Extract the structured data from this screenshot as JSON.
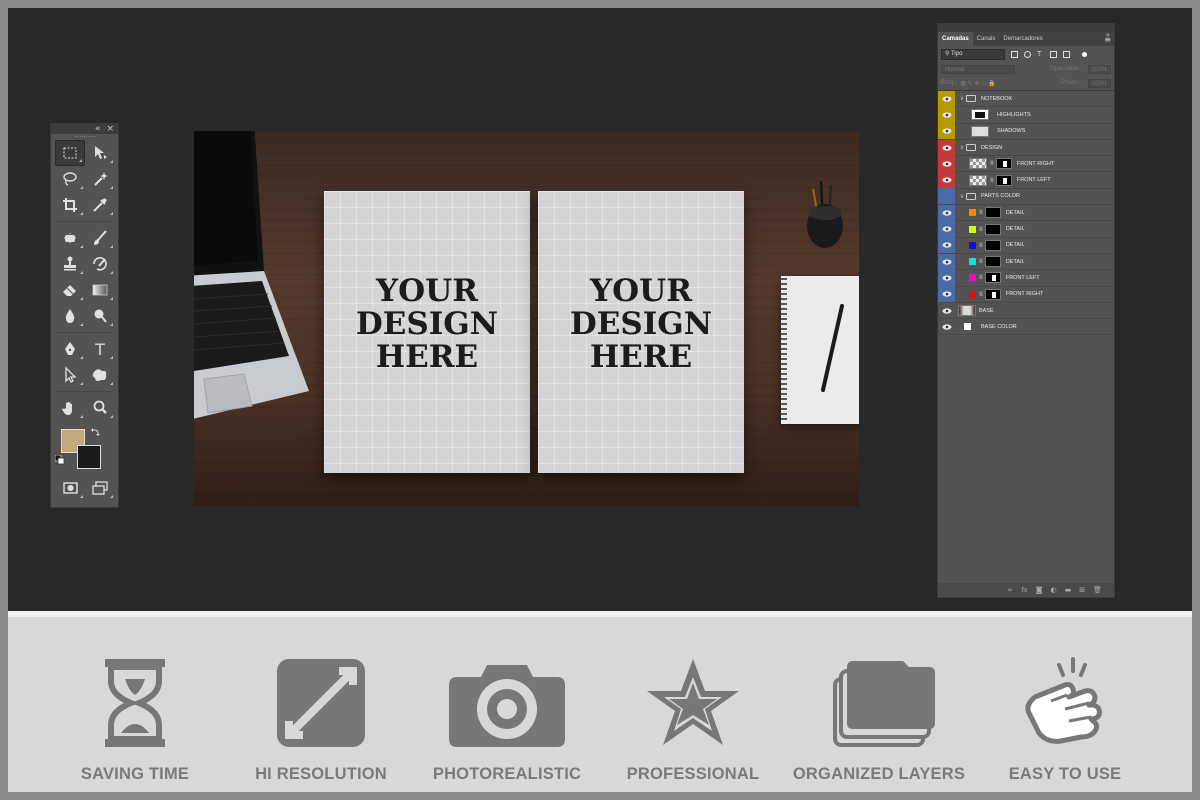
{
  "colors": {
    "workspace": "#282828",
    "panel": "#535353",
    "foreground_swatch": "#c4a87d",
    "background_swatch": "#1b1b1b",
    "feature_gray": "#777777",
    "feature_bar": "#d8d8d8"
  },
  "toolbar": {
    "collapse_icon": "double-chevron-left-icon",
    "close_icon": "close-icon",
    "text_tool_glyph": "T",
    "tools": [
      "marquee-icon",
      "move-icon",
      "lasso-icon",
      "magic-wand-icon",
      "crop-icon",
      "eyedropper-icon",
      "spot-healing-icon",
      "brush-icon",
      "clone-stamp-icon",
      "history-brush-icon",
      "eraser-icon",
      "gradient-icon",
      "blur-icon",
      "dodge-icon",
      "pen-icon",
      "type-icon",
      "path-selection-icon",
      "shape-icon",
      "hand-icon",
      "zoom-icon",
      "quick-mask-icon",
      "screen-mode-icon"
    ]
  },
  "canvas": {
    "left_page_text": "YOUR\nDESIGN\nHERE",
    "right_page_text": "YOUR\nDESIGN\nHERE"
  },
  "layers_panel": {
    "tabs": [
      "Camadas",
      "Canais",
      "Demarcadores"
    ],
    "active_tab": "Camadas",
    "filter_label": "Tipo",
    "blend_mode": "Normal",
    "opacity_label": "Opacidade:",
    "opacity_value": "100%",
    "lock_label": "Bloq.:",
    "fill_label": "Preen.:",
    "fill_value": "100%",
    "layers": [
      {
        "name": "NOTEBOOK",
        "kind": "group",
        "color": "#b59a00",
        "indent": 0
      },
      {
        "name": "HIGHLIGHTS",
        "kind": "layer",
        "color": "#b59a00",
        "indent": 1
      },
      {
        "name": "SHADOWS",
        "kind": "layer",
        "color": "#b59a00",
        "indent": 1
      },
      {
        "name": "DESIGN",
        "kind": "group",
        "color": "#c23a3a",
        "indent": 0
      },
      {
        "name": "FRONT RIGHT",
        "kind": "smart",
        "color": "#c23a3a",
        "indent": 1
      },
      {
        "name": "FRONT LEFT",
        "kind": "smart",
        "color": "#c23a3a",
        "indent": 1
      },
      {
        "name": "PARTS COLOR",
        "kind": "group",
        "color": "#4a6aa8",
        "indent": 0
      },
      {
        "name": "DETAIL",
        "kind": "fill",
        "chip": "#ff8800",
        "color": "#4a6aa8",
        "indent": 1
      },
      {
        "name": "DETAIL",
        "kind": "fill",
        "chip": "#c8ff00",
        "color": "#4a6aa8",
        "indent": 1
      },
      {
        "name": "DETAIL",
        "kind": "fill",
        "chip": "#1010e0",
        "color": "#4a6aa8",
        "indent": 1
      },
      {
        "name": "DETAIL",
        "kind": "fill",
        "chip": "#00e6e6",
        "color": "#4a6aa8",
        "indent": 1
      },
      {
        "name": "FRONT LEFT",
        "kind": "fill",
        "chip": "#ff00c8",
        "color": "#4a6aa8",
        "indent": 1
      },
      {
        "name": "FRONT RIGHT",
        "kind": "fill",
        "chip": "#e01010",
        "color": "#4a6aa8",
        "indent": 1
      },
      {
        "name": "BASE",
        "kind": "image",
        "color": "",
        "indent": 0
      },
      {
        "name": "BASE COLOR",
        "kind": "solid",
        "color": "",
        "indent": 0
      }
    ],
    "footer_icons": [
      "link-icon",
      "fx-icon",
      "mask-icon",
      "adjustment-icon",
      "folder-icon",
      "new-layer-icon",
      "trash-icon"
    ]
  },
  "features": [
    {
      "label": "SAVING TIME",
      "icon": "hourglass-icon"
    },
    {
      "label": "HI RESOLUTION",
      "icon": "expand-icon"
    },
    {
      "label": "PHOTOREALISTIC",
      "icon": "camera-icon"
    },
    {
      "label": "PROFESSIONAL",
      "icon": "star-icon"
    },
    {
      "label": "ORGANIZED LAYERS",
      "icon": "layers-icon"
    },
    {
      "label": "EASY TO USE",
      "icon": "tap-hand-icon"
    }
  ]
}
